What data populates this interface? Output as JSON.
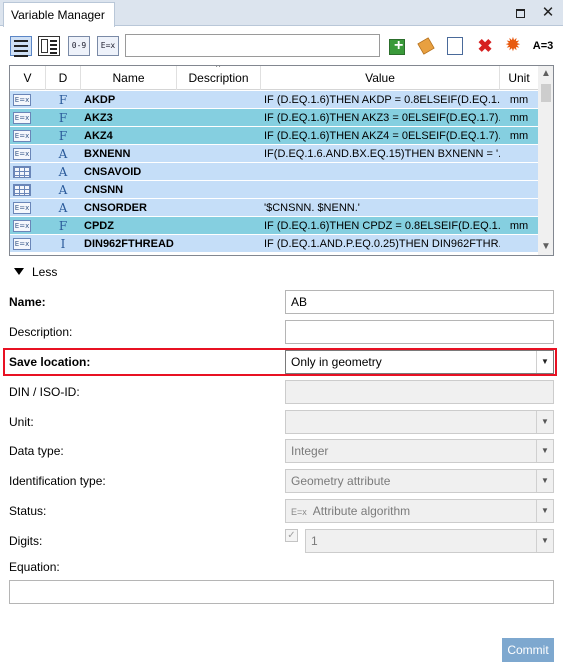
{
  "window": {
    "title": "Variable Manager",
    "maximize_icon": "maximize-icon",
    "close_icon": "close-icon"
  },
  "toolbar": {
    "icons": [
      "list-view-icon",
      "detail-view-icon",
      "label-icon-1",
      "label-icon-2",
      "add-variable-icon",
      "edit-variable-icon",
      "copy-variable-icon",
      "delete-icon",
      "warning-gear-icon",
      "assign-icon"
    ],
    "label1": "0-9",
    "label2": "E=x",
    "assign_text": "A=3",
    "search_value": ""
  },
  "table": {
    "headers": {
      "v": "V",
      "d": "D",
      "name": "Name",
      "description": "Description",
      "value": "Value",
      "unit": "Unit"
    },
    "rows": [
      {
        "v": "E=x",
        "d": "F",
        "name": "AKDP",
        "description": "",
        "value": "IF (D.EQ.1.6)THEN AKDP = 0.8ELSEIF(D.EQ.1....",
        "unit": "mm",
        "style": "blue"
      },
      {
        "v": "E=x",
        "d": "F",
        "name": "AKZ3",
        "description": "",
        "value": "IF (D.EQ.1.6)THEN AKZ3 = 0ELSEIF(D.EQ.1.7)...",
        "unit": "mm",
        "style": "teal"
      },
      {
        "v": "E=x",
        "d": "F",
        "name": "AKZ4",
        "description": "",
        "value": "IF (D.EQ.1.6)THEN AKZ4 = 0ELSEIF(D.EQ.1.7)...",
        "unit": "mm",
        "style": "teal"
      },
      {
        "v": "E=x",
        "d": "A",
        "name": "BXNENN",
        "description": "",
        "value": "IF(D.EQ.1.6.AND.BX.EQ.15)THEN BXNENN = '...",
        "unit": "",
        "style": "blue"
      },
      {
        "v": "grid",
        "d": "A",
        "name": "CNSAVOID",
        "description": "",
        "value": "",
        "unit": "",
        "style": "blue"
      },
      {
        "v": "grid",
        "d": "A",
        "name": "CNSNN",
        "description": "",
        "value": "",
        "unit": "",
        "style": "blue"
      },
      {
        "v": "E=x",
        "d": "A",
        "name": "CNSORDER",
        "description": "",
        "value": "'$CNSNN. $NENN.'",
        "unit": "",
        "style": "blue"
      },
      {
        "v": "E=x",
        "d": "F",
        "name": "CPDZ",
        "description": "",
        "value": "IF (D.EQ.1.6)THEN CPDZ = 0.8ELSEIF(D.EQ.1....",
        "unit": "mm",
        "style": "teal"
      },
      {
        "v": "E=x",
        "d": "I",
        "name": "DIN962FTHREAD",
        "description": "",
        "value": "IF (D.EQ.1.AND.P.EQ.0.25)THEN DIN962FTHR...",
        "unit": "",
        "style": "blue"
      }
    ]
  },
  "less_label": "Less",
  "form": {
    "name_label": "Name:",
    "name_value": "AB",
    "description_label": "Description:",
    "description_value": "",
    "save_location_label": "Save location:",
    "save_location_value": "Only in geometry",
    "din_label": "DIN / ISO-ID:",
    "din_value": "",
    "unit_label": "Unit:",
    "unit_value": "",
    "data_type_label": "Data type:",
    "data_type_value": "Integer",
    "identification_label": "Identification type:",
    "identification_value": "Geometry attribute",
    "status_label": "Status:",
    "status_value": "Attribute algorithm",
    "status_icon": "E=x",
    "digits_label": "Digits:",
    "digits_value": "1",
    "equation_label": "Equation:",
    "equation_value": ""
  },
  "commit_label": "Commit",
  "highlight_color": "#e81123"
}
